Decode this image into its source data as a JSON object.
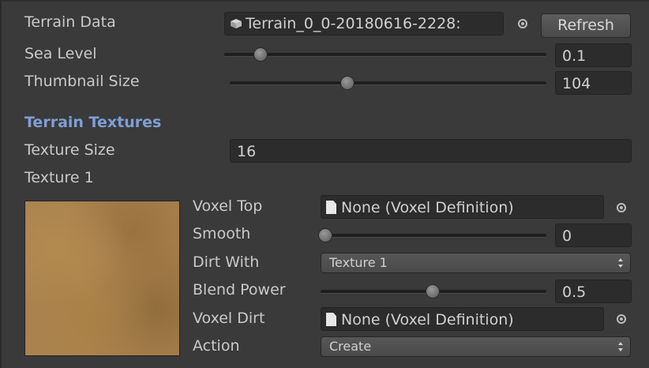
{
  "terrain_data": {
    "label": "Terrain Data",
    "value": "Terrain_0_0-20180616-2228:",
    "button": "Refresh"
  },
  "sea_level": {
    "label": "Sea Level",
    "value": "0.1",
    "slider_fraction": 0.1
  },
  "thumbnail_size": {
    "label": "Thumbnail Size",
    "value": "104",
    "slider_fraction": 0.37
  },
  "section_title": "Terrain Textures",
  "texture_size": {
    "label": "Texture Size",
    "value": "16"
  },
  "texture": {
    "title": "Texture 1",
    "voxel_top": {
      "label": "Voxel Top",
      "value": "None (Voxel Definition)"
    },
    "smooth": {
      "label": "Smooth",
      "value": "0",
      "slider_fraction": 0.0
    },
    "dirt_with": {
      "label": "Dirt With",
      "value": "Texture 1"
    },
    "blend_power": {
      "label": "Blend Power",
      "value": "0.5",
      "slider_fraction": 0.5
    },
    "voxel_dirt": {
      "label": "Voxel Dirt",
      "value": "None (Voxel Definition)"
    },
    "action": {
      "label": "Action",
      "value": "Create"
    }
  },
  "colors": {
    "background": "#3a3a3a",
    "field": "#2c2c2c",
    "section_title": "#7e9fd6",
    "text": "#c9c9c9"
  },
  "icons": [
    "object-picker-icon",
    "document-icon",
    "prefab-cube-icon",
    "dropdown-arrows-icon"
  ]
}
